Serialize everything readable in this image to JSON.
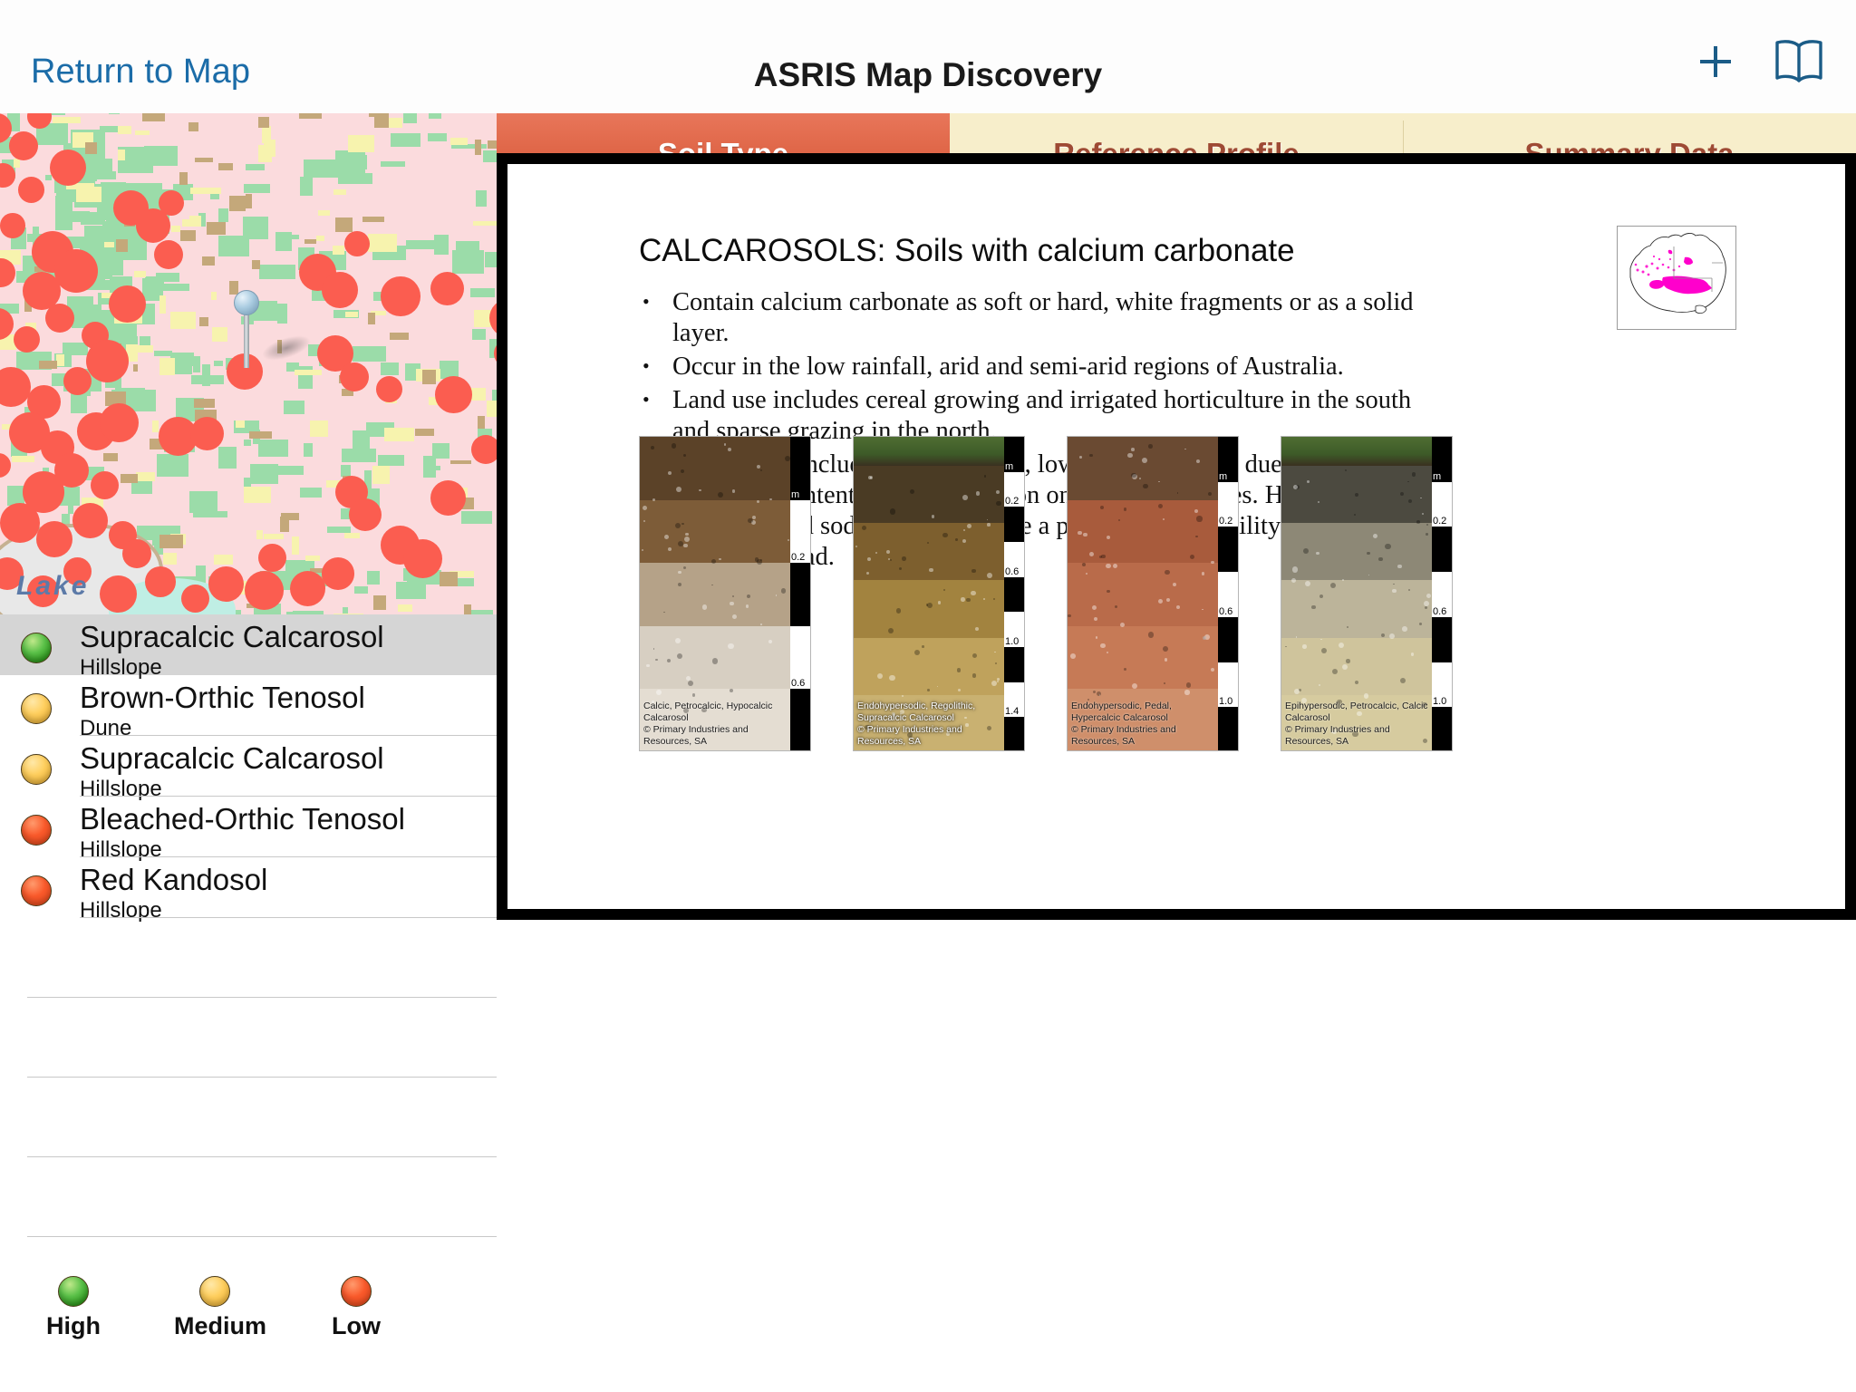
{
  "navbar": {
    "back_label": "Return to Map",
    "title": "ASRIS Map Discovery",
    "add_icon": "plus-icon",
    "book_icon": "open-book-icon"
  },
  "map": {
    "label": "Lake",
    "pin_icon": "map-pin-icon"
  },
  "soil_list": [
    {
      "name": "Supracalcic Calcarosol",
      "landform": "Hillslope",
      "confidence": "high",
      "selected": true
    },
    {
      "name": "Brown-Orthic Tenosol",
      "landform": "Dune",
      "confidence": "medium",
      "selected": false
    },
    {
      "name": "Supracalcic Calcarosol",
      "landform": "Hillslope",
      "confidence": "medium",
      "selected": false
    },
    {
      "name": "Bleached-Orthic Tenosol",
      "landform": "Hillslope",
      "confidence": "low",
      "selected": false
    },
    {
      "name": "Red Kandosol",
      "landform": "Hillslope",
      "confidence": "low",
      "selected": false
    }
  ],
  "legend": {
    "items": [
      {
        "label": "High",
        "confidence": "high",
        "color": "#5cc24a"
      },
      {
        "label": "Medium",
        "confidence": "medium",
        "color": "#ffcf5e"
      },
      {
        "label": "Low",
        "confidence": "low",
        "color": "#fa5a2b"
      }
    ]
  },
  "tabs": [
    {
      "label": "Soil Type",
      "active": true
    },
    {
      "label": "Reference Profile",
      "active": false
    },
    {
      "label": "Summary Data",
      "active": false
    }
  ],
  "slide": {
    "title": "CALCAROSOLS: Soils with calcium carbonate",
    "bullets": [
      "Contain calcium carbonate as soft or hard, white fragments or as a solid layer.",
      "Occur in the low rainfall, arid and semi-arid regions of Australia.",
      "Land use includes cereal growing and irrigated horticulture in the south and sparse grazing in the north.",
      "Limitations include shallow depth, low water retention due to hard carbonate content and wind erosion on the sandier types. High salinity, alkalinity and sodicity may also be a problem. Soil fertility deficiencies are widespread."
    ],
    "inset_map_label": "australia-distribution-map",
    "inset_highlight_color": "#ff00cc",
    "profiles": [
      {
        "caption_line1": "Calcic, Petrocalcic, Hypocalcic Calcarosol",
        "caption_line2": "© Primary Industries and Resources, SA",
        "scale_unit": "m",
        "scale_ticks": [
          "0.2",
          "0.6"
        ],
        "caption_style": "dark"
      },
      {
        "caption_line1": "Endohypersodic, Regolithic, Supracalcic Calcarosol",
        "caption_line2": "© Primary Industries and Resources, SA",
        "scale_unit": "m",
        "scale_ticks": [
          "0.2",
          "0.6",
          "1.0",
          "1.4"
        ],
        "caption_style": "light"
      },
      {
        "caption_line1": "Endohypersodic, Pedal, Hypercalcic Calcarosol",
        "caption_line2": "© Primary Industries and Resources, SA",
        "scale_unit": "m",
        "scale_ticks": [
          "0.2",
          "0.6",
          "1.0"
        ],
        "caption_style": "dark"
      },
      {
        "caption_line1": "Epihypersodic, Petrocalcic, Calcic Calcarosol",
        "caption_line2": "© Primary Industries and Resources, SA",
        "scale_unit": "m",
        "scale_ticks": [
          "0.2",
          "0.6",
          "1.0"
        ],
        "caption_style": "dark"
      }
    ]
  }
}
